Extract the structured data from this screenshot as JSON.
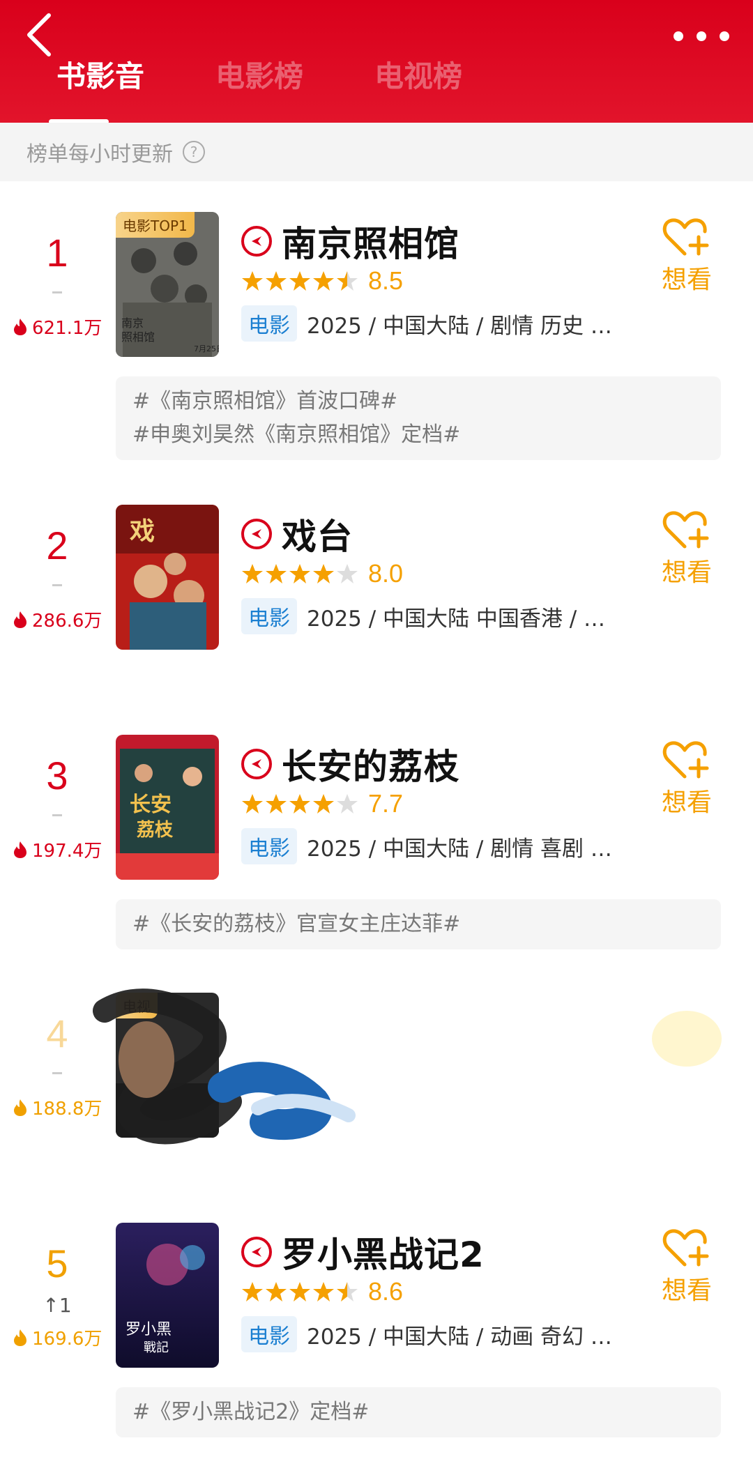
{
  "header": {
    "tabs": [
      {
        "label": "书影音",
        "active": true
      },
      {
        "label": "电影榜",
        "active": false
      },
      {
        "label": "电视榜",
        "active": false
      }
    ],
    "subtitle": "榜单每小时更新",
    "help_icon": "?"
  },
  "colors": {
    "brand_red": "#d9001b",
    "accent_orange": "#f5a000",
    "badge_blue": "#1b7fd1"
  },
  "items": [
    {
      "rank": "1",
      "rank_change": "",
      "heat": "621.1万",
      "poster_tag": "电影TOP1",
      "title": "南京照相馆",
      "rating": 8.5,
      "score": "8.5",
      "stars": 4.5,
      "type": "电影",
      "meta": "2025 / 中国大陆 / 剧情 历史 …",
      "want": "想看",
      "tags": [
        "#《南京照相馆》首波口碑#",
        "#申奥刘昊然《南京照相馆》定档#"
      ]
    },
    {
      "rank": "2",
      "rank_change": "",
      "heat": "286.6万",
      "poster_tag": "",
      "title": "戏台",
      "rating": 8.0,
      "score": "8.0",
      "stars": 4,
      "type": "电影",
      "meta": "2025 / 中国大陆 中国香港 / …",
      "want": "想看",
      "tags": []
    },
    {
      "rank": "3",
      "rank_change": "",
      "heat": "197.4万",
      "poster_tag": "",
      "title": "长安的荔枝",
      "rating": 7.7,
      "score": "7.7",
      "stars": 4,
      "type": "电影",
      "meta": "2025 / 中国大陆 / 剧情 喜剧 …",
      "want": "想看",
      "tags": [
        "#《长安的荔枝》官宣女主庄达菲#"
      ]
    },
    {
      "rank": "4",
      "rank_change": "",
      "heat": "188.8万",
      "poster_tag": "电视",
      "title": "",
      "meta": "",
      "want": ""
    },
    {
      "rank": "5",
      "rank_change": "↑1",
      "heat": "169.6万",
      "poster_tag": "",
      "title": "罗小黑战记2",
      "rating": 8.6,
      "score": "8.6",
      "stars": 4.5,
      "type": "电影",
      "meta": "2025 / 中国大陆 / 动画 奇幻 …",
      "want": "想看",
      "tags": [
        "#《罗小黑战记2》定档#"
      ]
    }
  ]
}
